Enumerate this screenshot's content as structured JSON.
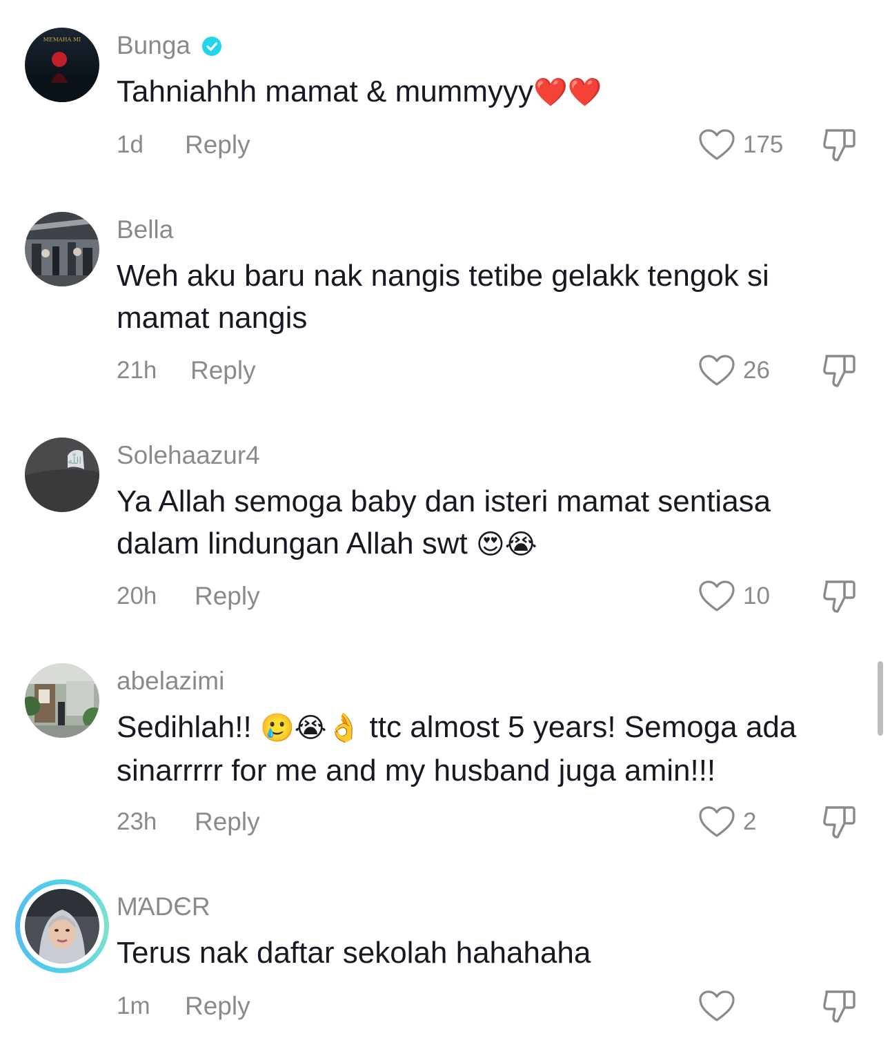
{
  "comments": [
    {
      "username": "Bunga",
      "verified": true,
      "avatar_text": "MEMAHA MI",
      "text": "Tahniahhh mamat & mummyyy",
      "emojis": "❤️❤️",
      "time": "1d",
      "reply": "Reply",
      "likes": "175"
    },
    {
      "username": "Bella",
      "verified": false,
      "text": "Weh aku baru nak nangis tetibe gelakk tengok si mamat nangis",
      "emojis": "",
      "time": "21h",
      "reply": "Reply",
      "likes": "26"
    },
    {
      "username": "Solehaazur4",
      "verified": false,
      "text": "Ya Allah semoga baby dan isteri mamat sentiasa dalam lindungan Allah swt",
      "emojis": "😍😭",
      "time": "20h",
      "reply": "Reply",
      "likes": "10"
    },
    {
      "username": "abelazimi",
      "verified": false,
      "text_before": "Sedihlah!!",
      "emojis": "🥲😭👌",
      "text_after": "ttc almost 5 years! Semoga ada sinarrrrr for me and my husband juga amin!!!",
      "time": "23h",
      "reply": "Reply",
      "likes": "2"
    },
    {
      "username": "MΆDЄR",
      "verified": false,
      "has_story_ring": true,
      "text": "Terus nak daftar sekolah hahahaha",
      "emojis": "",
      "time": "1m",
      "reply": "Reply",
      "likes": ""
    }
  ],
  "icons": {
    "like": "heart-outline-icon",
    "dislike": "thumbs-down-icon",
    "verified": "verified-badge-icon"
  },
  "colors": {
    "text": "#161823",
    "secondary": "#8a8a8e",
    "verified": "#20d5ec",
    "story_ring": "#4fd1e8"
  }
}
